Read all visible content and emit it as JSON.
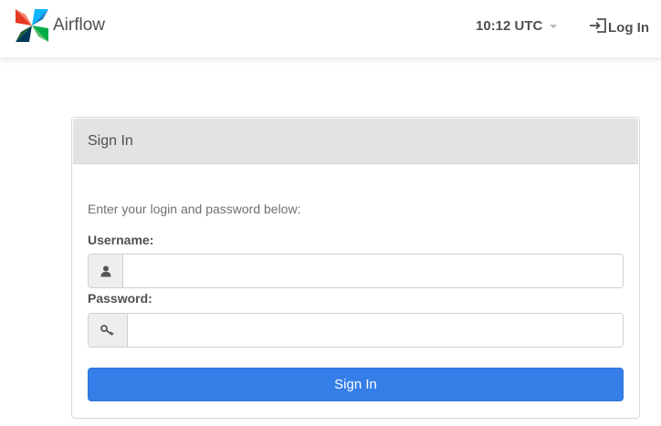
{
  "brand": {
    "name": "Airflow",
    "logo_icon": "airflow-pinwheel-icon"
  },
  "navbar": {
    "clock_text": "10:12 UTC",
    "login_label": "Log In",
    "login_icon": "sign-in-icon"
  },
  "login_panel": {
    "heading": "Sign In",
    "instructions": "Enter your login and password below:",
    "username": {
      "label": "Username:",
      "icon": "user-icon",
      "value": "",
      "placeholder": ""
    },
    "password": {
      "label": "Password:",
      "icon": "key-icon",
      "value": "",
      "placeholder": ""
    },
    "submit_label": "Sign In"
  },
  "colors": {
    "primary_button": "#357ee8",
    "panel_heading_bg": "#e2e3e2",
    "text": "#51504f",
    "logo_red": "#e43921",
    "logo_blue": "#0cb6ff",
    "logo_green": "#00ad46",
    "logo_navy": "#04d659"
  }
}
